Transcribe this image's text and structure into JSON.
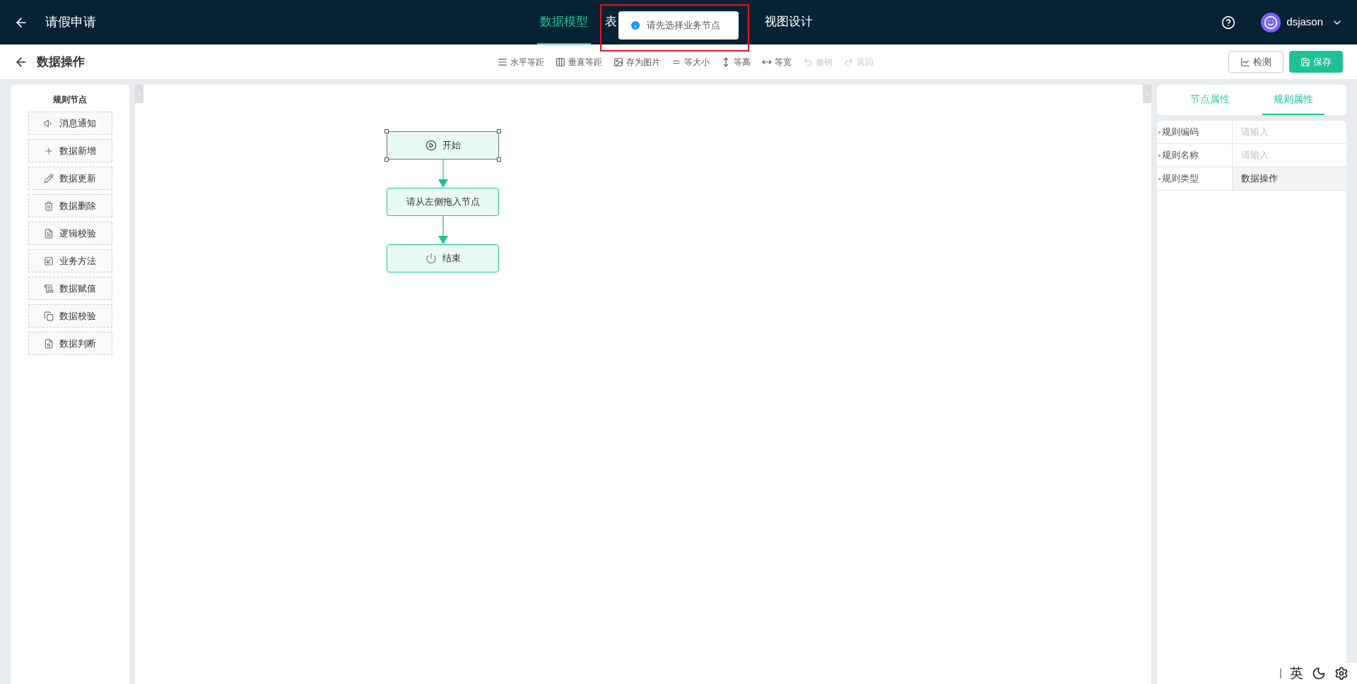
{
  "header": {
    "title": "请假申请",
    "tabs": [
      {
        "label": "数据模型",
        "selected": true
      },
      {
        "label": "表",
        "selected": false
      },
      {
        "label": "视图设计",
        "selected": false
      }
    ],
    "user": {
      "name": "dsjason"
    }
  },
  "toast": {
    "message": "请先选择业务节点"
  },
  "subheader": {
    "title": "数据操作",
    "buttons": [
      {
        "label": "检测",
        "kind": "default"
      },
      {
        "label": "保存",
        "kind": "primary"
      }
    ]
  },
  "toolbar": [
    {
      "label": "水平等距",
      "disabled": false
    },
    {
      "label": "垂直等距",
      "disabled": false
    },
    {
      "label": "存为图片",
      "disabled": false
    },
    {
      "label": "等大小",
      "disabled": false
    },
    {
      "label": "等高",
      "disabled": false
    },
    {
      "label": "等宽",
      "disabled": false
    },
    {
      "label": "撤销",
      "disabled": true
    },
    {
      "label": "返回",
      "disabled": true
    }
  ],
  "palette": {
    "title": "规则节点",
    "items": [
      {
        "label": "消息通知"
      },
      {
        "label": "数据新增"
      },
      {
        "label": "数据更新"
      },
      {
        "label": "数据删除"
      },
      {
        "label": "逻辑校验"
      },
      {
        "label": "业务方法"
      },
      {
        "label": "数据赋值"
      },
      {
        "label": "数据校验"
      },
      {
        "label": "数据判断"
      }
    ]
  },
  "flow": {
    "nodes": [
      {
        "label": "开始",
        "kind": "start",
        "selected": true
      },
      {
        "label": "请从左侧拖入节点",
        "kind": "placeholder",
        "selected": false
      },
      {
        "label": "结束",
        "kind": "end",
        "selected": false
      }
    ]
  },
  "properties": {
    "tabs": [
      {
        "label": "节点属性",
        "selected": false
      },
      {
        "label": "规则属性",
        "selected": true
      }
    ],
    "fields": [
      {
        "label": "规则编码",
        "required": true,
        "placeholder": "请输入",
        "readonly": false
      },
      {
        "label": "规则名称",
        "required": true,
        "placeholder": "请输入",
        "readonly": false
      },
      {
        "label": "规则类型",
        "required": true,
        "value": "数据操作",
        "readonly": true
      }
    ]
  },
  "ime_bar": {
    "label": "英"
  }
}
